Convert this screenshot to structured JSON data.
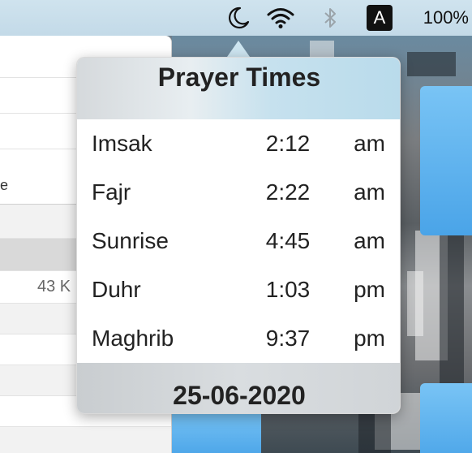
{
  "menubar": {
    "prayer_icon": "crescent-moon-icon",
    "wifi_icon": "wifi-icon",
    "bluetooth_icon": "bluetooth-icon",
    "input_source": "A",
    "battery": "100%"
  },
  "finder": {
    "partial_column_label": "e",
    "partial_size": "43 K"
  },
  "popover": {
    "title": "Prayer Times",
    "prayers": [
      {
        "name": "Imsak",
        "time": "2:12",
        "period": "am"
      },
      {
        "name": "Fajr",
        "time": "2:22",
        "period": "am"
      },
      {
        "name": "Sunrise",
        "time": "4:45",
        "period": "am"
      },
      {
        "name": "Duhr",
        "time": "1:03",
        "period": "pm"
      },
      {
        "name": "Maghrib",
        "time": "9:37",
        "period": "pm"
      }
    ],
    "date": "25-06-2020"
  },
  "colors": {
    "menubar": "#c8dde9",
    "folder": "#5ab3ef",
    "input_badge": "#111111"
  }
}
